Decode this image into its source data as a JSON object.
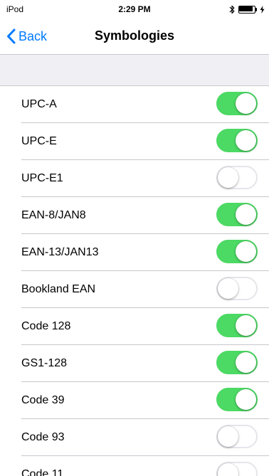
{
  "status_bar": {
    "device": "iPod",
    "time": "2:29 PM",
    "icons": [
      "bluetooth-icon",
      "battery-icon",
      "charging-bolt-icon"
    ],
    "battery_level": 0.92
  },
  "nav": {
    "back_label": "Back",
    "title": "Symbologies"
  },
  "colors": {
    "accent": "#007aff",
    "toggle_on": "#4cd964",
    "toggle_off_border": "#e5e5ea",
    "separator": "#c8c7cc",
    "group_background": "#efeff4"
  },
  "symbologies": [
    {
      "label": "UPC-A",
      "enabled": true
    },
    {
      "label": "UPC-E",
      "enabled": true
    },
    {
      "label": "UPC-E1",
      "enabled": false
    },
    {
      "label": "EAN-8/JAN8",
      "enabled": true
    },
    {
      "label": "EAN-13/JAN13",
      "enabled": true
    },
    {
      "label": "Bookland EAN",
      "enabled": false
    },
    {
      "label": "Code 128",
      "enabled": true
    },
    {
      "label": "GS1-128",
      "enabled": true
    },
    {
      "label": "Code 39",
      "enabled": true
    },
    {
      "label": "Code 93",
      "enabled": false
    },
    {
      "label": "Code 11",
      "enabled": false
    }
  ]
}
